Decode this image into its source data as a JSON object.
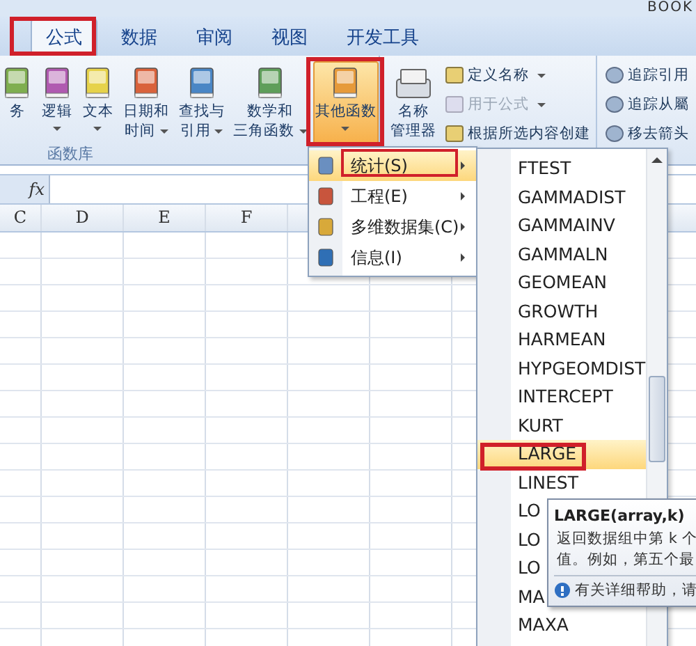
{
  "window": {
    "title": "BOOK"
  },
  "tabs": [
    {
      "label": "公式",
      "selected": true
    },
    {
      "label": "数据",
      "selected": false
    },
    {
      "label": "审阅",
      "selected": false
    },
    {
      "label": "视图",
      "selected": false
    },
    {
      "label": "开发工具",
      "selected": false
    }
  ],
  "ribbon": {
    "function_library": {
      "label": "函数库",
      "buttons": [
        {
          "lines": [
            "务"
          ],
          "color": "#7fae4f",
          "dropdown": false,
          "selected": false
        },
        {
          "lines": [
            "逻辑"
          ],
          "color": "#b05ab0",
          "dropdown": true,
          "selected": false
        },
        {
          "lines": [
            "文本"
          ],
          "color": "#e6d24a",
          "dropdown": true,
          "selected": false
        },
        {
          "lines": [
            "日期和",
            "时间"
          ],
          "color": "#d9623b",
          "dropdown": true,
          "selected": false
        },
        {
          "lines": [
            "查找与",
            "引用"
          ],
          "color": "#4a86c5",
          "dropdown": true,
          "selected": false
        },
        {
          "lines": [
            "数学和",
            "三角函数"
          ],
          "color": "#5f9e5a",
          "dropdown": true,
          "selected": false
        },
        {
          "lines": [
            "其他函数"
          ],
          "color": "#e69a3a",
          "dropdown": true,
          "selected": true
        }
      ]
    },
    "name_manager": {
      "lines": [
        "名称",
        "管理器"
      ]
    },
    "name_commands": [
      {
        "label": "定义名称",
        "dropdown": true,
        "disabled": false
      },
      {
        "label": "用于公式",
        "dropdown": true,
        "disabled": true
      },
      {
        "label": "根据所选内容创建",
        "dropdown": false,
        "disabled": false
      }
    ],
    "audit_commands": [
      {
        "label": "追踪引用"
      },
      {
        "label": "追踪从屬"
      },
      {
        "label": "移去箭头"
      }
    ]
  },
  "formula_bar": {
    "fx": "fx"
  },
  "sheet": {
    "columns": [
      "C",
      "D",
      "E",
      "F"
    ]
  },
  "menu": [
    {
      "label": "统计(S)",
      "selected": true,
      "color": "#6a8fc0"
    },
    {
      "label": "工程(E)",
      "selected": false,
      "color": "#c8553d"
    },
    {
      "label": "多维数据集(C)",
      "selected": false,
      "color": "#d8a93a"
    },
    {
      "label": "信息(I)",
      "selected": false,
      "color": "#2f6fb5"
    }
  ],
  "function_list": [
    {
      "label": "FTEST",
      "selected": false
    },
    {
      "label": "GAMMADIST",
      "selected": false
    },
    {
      "label": "GAMMAINV",
      "selected": false
    },
    {
      "label": "GAMMALN",
      "selected": false
    },
    {
      "label": "GEOMEAN",
      "selected": false
    },
    {
      "label": "GROWTH",
      "selected": false
    },
    {
      "label": "HARMEAN",
      "selected": false
    },
    {
      "label": "HYPGEOMDIST",
      "selected": false
    },
    {
      "label": "INTERCEPT",
      "selected": false
    },
    {
      "label": "KURT",
      "selected": false
    },
    {
      "label": "LARGE",
      "selected": true
    },
    {
      "label": "LINEST",
      "selected": false
    },
    {
      "label": "LO",
      "selected": false
    },
    {
      "label": "LO",
      "selected": false
    },
    {
      "label": "LO",
      "selected": false
    },
    {
      "label": "MA",
      "selected": false
    },
    {
      "label": "MAXA",
      "selected": false
    }
  ],
  "tooltip": {
    "title": "LARGE(array,k)",
    "lines": [
      "返回数据组中第 k 个",
      "值。例如，第五个最"
    ],
    "help": "有关详细帮助，请"
  }
}
